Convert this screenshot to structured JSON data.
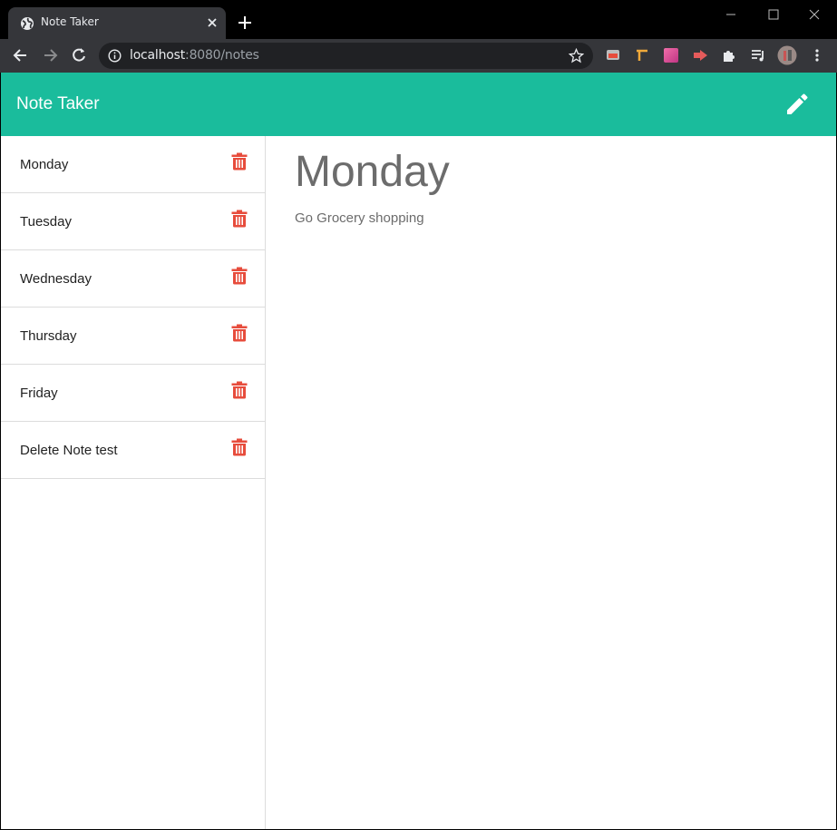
{
  "browser": {
    "tab_title": "Note Taker",
    "url_host": "localhost",
    "url_rest": ":8080/notes"
  },
  "app": {
    "title": "Note Taker",
    "accent_color": "#1abc9c",
    "delete_color": "#e74c3c"
  },
  "notes": [
    {
      "title": "Monday"
    },
    {
      "title": "Tuesday"
    },
    {
      "title": "Wednesday"
    },
    {
      "title": "Thursday"
    },
    {
      "title": "Friday"
    },
    {
      "title": "Delete Note test"
    }
  ],
  "active_note": {
    "title": "Monday",
    "text": "Go Grocery shopping"
  },
  "icons": {
    "edit": "pencil-icon",
    "delete": "trash-icon"
  }
}
